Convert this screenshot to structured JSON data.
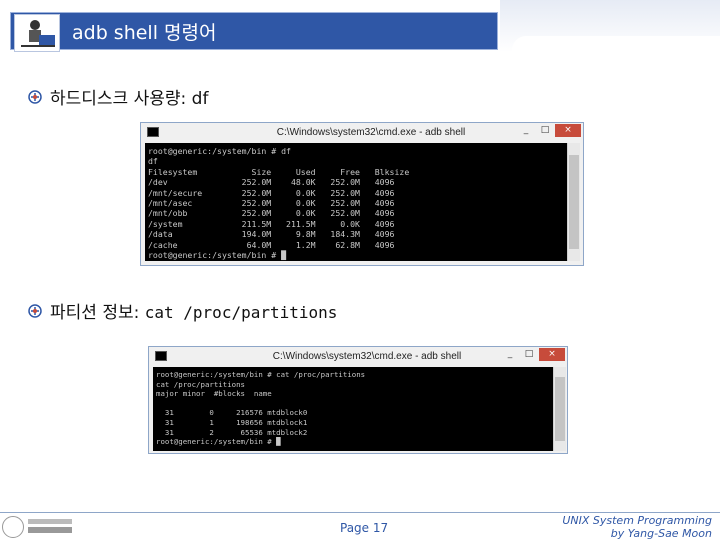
{
  "header": {
    "title": "adb shell 명령어"
  },
  "bullets": [
    {
      "label": "하드디스크 사용량: ",
      "command": "df"
    },
    {
      "label": "파티션 정보: ",
      "command": "cat /proc/partitions"
    }
  ],
  "window1": {
    "title": "C:\\Windows\\system32\\cmd.exe - adb  shell",
    "minimize": "_",
    "maximize": "□",
    "close": "×",
    "lines": [
      "root@generic:/system/bin # df",
      "df",
      "Filesystem           Size     Used     Free   Blksize",
      "/dev               252.0M    48.0K   252.0M   4096",
      "/mnt/secure        252.0M     0.0K   252.0M   4096",
      "/mnt/asec          252.0M     0.0K   252.0M   4096",
      "/mnt/obb           252.0M     0.0K   252.0M   4096",
      "/system            211.5M   211.5M     0.0K   4096",
      "/data              194.0M     9.8M   184.3M   4096",
      "/cache              64.0M     1.2M    62.8M   4096",
      "root@generic:/system/bin # "
    ]
  },
  "window2": {
    "title": "C:\\Windows\\system32\\cmd.exe - adb  shell",
    "minimize": "_",
    "maximize": "□",
    "close": "×",
    "lines": [
      "root@generic:/system/bin # cat /proc/partitions",
      "cat /proc/partitions",
      "major minor  #blocks  name",
      "",
      "  31        0     216576 mtdblock0",
      "  31        1     198656 mtdblock1",
      "  31        2      65536 mtdblock2",
      "root@generic:/system/bin # "
    ]
  },
  "footer": {
    "page": "Page 17",
    "credit_line1": "UNIX System Programming",
    "credit_line2": "by Yang-Sae Moon"
  }
}
